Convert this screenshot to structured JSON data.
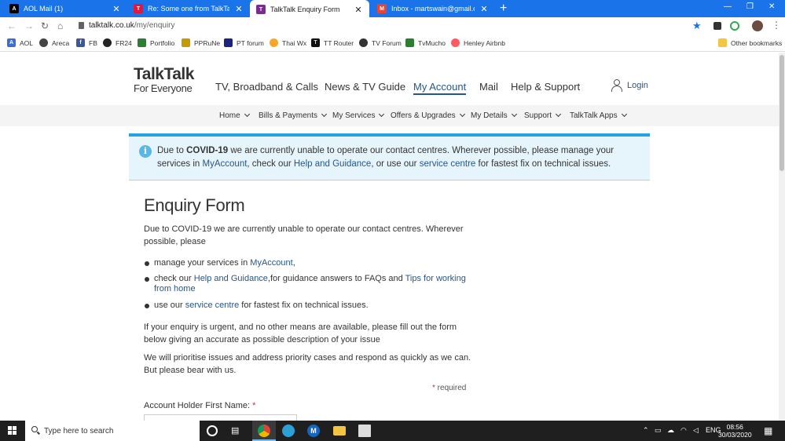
{
  "browser": {
    "tabs": [
      {
        "title": "AOL Mail (1)",
        "favicon": "aol-icon",
        "active": false
      },
      {
        "title": "Re: Some one from TalkTalk need",
        "favicon": "talktalk-icon",
        "active": false
      },
      {
        "title": "TalkTalk Enquiry Form",
        "favicon": "talktalk-icon",
        "active": true
      },
      {
        "title": "Inbox - martswain@gmail.com - ",
        "favicon": "gmail-icon",
        "active": false
      }
    ],
    "url_host": "talktalk.co.uk",
    "url_path": "/my/enquiry",
    "bookmarks": [
      {
        "label": "AOL",
        "icon": "aol-icon"
      },
      {
        "label": "Areca",
        "icon": "globe-icon"
      },
      {
        "label": "FB",
        "icon": "facebook-icon"
      },
      {
        "label": "FR24",
        "icon": "fr24-icon"
      },
      {
        "label": "Portfolio",
        "icon": "portfolio-icon"
      },
      {
        "label": "PPRuNe",
        "icon": "ppruneicon"
      },
      {
        "label": "PT forum",
        "icon": "pt-forum-icon"
      },
      {
        "label": "Thai Wx",
        "icon": "sun-icon"
      },
      {
        "label": "TT Router",
        "icon": "tt-router-icon"
      },
      {
        "label": "TV Forum",
        "icon": "tv-forum-icon"
      },
      {
        "label": "TvMucho",
        "icon": "tvmucho-icon"
      },
      {
        "label": "Henley Airbnb",
        "icon": "airbnb-icon"
      }
    ],
    "other_bookmarks": "Other bookmarks"
  },
  "site": {
    "logo_line1": "TalkTalk",
    "logo_line2": "For Everyone",
    "main_nav": [
      "TV, Broadband & Calls",
      "News & TV Guide",
      "My Account",
      "Mail",
      "Help & Support"
    ],
    "active_main_nav": "My Account",
    "login": "Login",
    "sub_nav": [
      "Home",
      "Bills & Payments",
      "My Services",
      "Offers & Upgrades",
      "My Details",
      "Support",
      "TalkTalk Apps"
    ]
  },
  "alert": {
    "t1": "Due to ",
    "t2": "COVID-19",
    "t3": " we are currently unable to operate our contact centres. Wherever possible, please manage your services in ",
    "l1": "MyAccount",
    "t4": ", check our ",
    "l2": "Help and Guidance",
    "t5": ", or use our ",
    "l3": "service centre",
    "t6": " for fastest fix on technical issues."
  },
  "form": {
    "heading": "Enquiry Form",
    "intro": "Due to COVID-19 we are currently unable to operate our contact centres. Wherever possible, please",
    "b1_pre": "manage your services in ",
    "b1_link": "MyAccount",
    "b1_post": ",",
    "b2_pre": "check our ",
    "b2_link": "Help and Guidance",
    "b2_mid": ",for guidance answers to FAQs and ",
    "b2_link2": "Tips for working from home",
    "b3_pre": "use our ",
    "b3_link": "service centre",
    "b3_post": " for fastest fix on technical issues.",
    "urgent": "If your enquiry is urgent, and no other means are available, please fill out the form below giving an accurate as possible description of your issue",
    "priority": "We will prioritise issues and address priority cases and respond as quickly as we can. But please bear with us.",
    "required_star": "* ",
    "required_label": "required",
    "first_name_label": "Account Holder First Name: ",
    "label_star": "*"
  },
  "taskbar": {
    "search_placeholder": "Type here to search",
    "language": "ENG",
    "time": "08:56",
    "date": "30/03/2020"
  }
}
